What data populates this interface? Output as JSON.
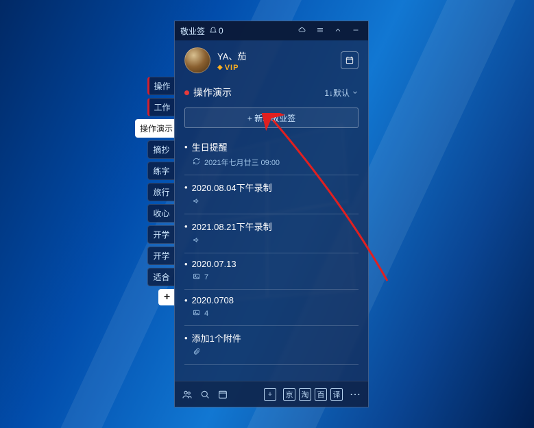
{
  "titlebar": {
    "app_name": "敬业签",
    "bell_count": "0"
  },
  "profile": {
    "username": "YA、茄",
    "vip_label": "VIP"
  },
  "category": {
    "title": "操作演示",
    "sort_label": "1↓默认"
  },
  "add_button_label": "+ 新增敬业签",
  "side_tabs": [
    {
      "label": "操作",
      "redbar": true
    },
    {
      "label": "工作",
      "redbar": true
    },
    {
      "label": "操作演示",
      "active": true
    },
    {
      "label": "摘抄"
    },
    {
      "label": "练字"
    },
    {
      "label": "旅行"
    },
    {
      "label": "收心"
    },
    {
      "label": "开学"
    },
    {
      "label": "开学"
    },
    {
      "label": "适合"
    }
  ],
  "notes": [
    {
      "title": "生日提醒",
      "meta_icon": "repeat",
      "meta_text": "2021年七月廿三 09:00"
    },
    {
      "title": "2020.08.04下午录制",
      "meta_icon": "audio",
      "meta_text": ""
    },
    {
      "title": "2021.08.21下午录制",
      "meta_icon": "audio",
      "meta_text": ""
    },
    {
      "title": "2020.07.13",
      "meta_icon": "image",
      "meta_text": "7"
    },
    {
      "title": "2020.0708",
      "meta_icon": "image",
      "meta_text": "4"
    },
    {
      "title": "添加1个附件",
      "meta_icon": "attachment",
      "meta_text": ""
    }
  ],
  "bottom_bar": {
    "shortcuts": [
      "京",
      "淘",
      "百",
      "译"
    ]
  }
}
